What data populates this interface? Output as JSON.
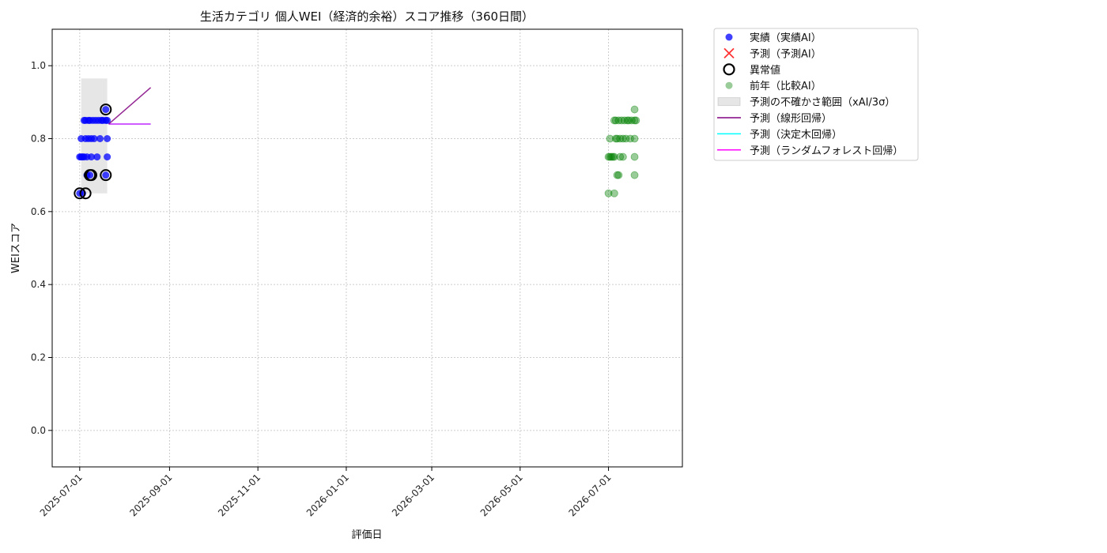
{
  "chart_data": {
    "type": "scatter",
    "title": "生活カテゴリ 個人WEI（経済的余裕）スコア推移（360日間）",
    "xlabel": "評価日",
    "ylabel": "WEIスコア",
    "x_type": "date",
    "xlim": [
      "2025-06-12",
      "2026-08-21"
    ],
    "ylim": [
      -0.1,
      1.1
    ],
    "grid": true,
    "legend_position": "outside-right-top",
    "x_ticks": [
      "2025-07-01",
      "2025-09-01",
      "2025-11-01",
      "2026-01-01",
      "2026-03-01",
      "2026-05-01",
      "2026-07-01"
    ],
    "y_ticks": [
      0.0,
      0.2,
      0.4,
      0.6,
      0.8,
      1.0
    ],
    "legend": [
      {
        "key": "actual",
        "label": "実績（実績AI）",
        "marker": "dot",
        "color": "#0000ff"
      },
      {
        "key": "forecast",
        "label": "予測（予測AI）",
        "marker": "x",
        "color": "#ff0000"
      },
      {
        "key": "anomaly",
        "label": "異常値",
        "marker": "ring",
        "color": "#000000"
      },
      {
        "key": "prev_year",
        "label": "前年（比較AI）",
        "marker": "dot",
        "color": "#008000"
      },
      {
        "key": "uncertainty",
        "label": "予測の不確かさ範囲（xAI/3σ）",
        "marker": "patch",
        "color": "#cccccc"
      },
      {
        "key": "linear",
        "label": "予測（線形回帰）",
        "marker": "line",
        "color": "#800080"
      },
      {
        "key": "tree",
        "label": "予測（決定木回帰）",
        "marker": "line",
        "color": "#00ffff"
      },
      {
        "key": "forest",
        "label": "予測（ランダムフォレスト回帰）",
        "marker": "line",
        "color": "#ff00ff"
      }
    ],
    "series": [
      {
        "key": "actual",
        "name": "実績（実績AI）",
        "color": "#0000ff",
        "points": [
          {
            "x": "2025-07-01",
            "y": 0.65
          },
          {
            "x": "2025-07-01",
            "y": 0.75
          },
          {
            "x": "2025-07-02",
            "y": 0.8
          },
          {
            "x": "2025-07-02",
            "y": 0.75
          },
          {
            "x": "2025-07-03",
            "y": 0.65
          },
          {
            "x": "2025-07-03",
            "y": 0.75
          },
          {
            "x": "2025-07-04",
            "y": 0.85
          },
          {
            "x": "2025-07-04",
            "y": 0.75
          },
          {
            "x": "2025-07-05",
            "y": 0.8
          },
          {
            "x": "2025-07-05",
            "y": 0.85
          },
          {
            "x": "2025-07-06",
            "y": 0.7
          },
          {
            "x": "2025-07-06",
            "y": 0.75
          },
          {
            "x": "2025-07-07",
            "y": 0.8
          },
          {
            "x": "2025-07-07",
            "y": 0.85
          },
          {
            "x": "2025-07-08",
            "y": 0.7
          },
          {
            "x": "2025-07-08",
            "y": 0.85
          },
          {
            "x": "2025-07-09",
            "y": 0.8
          },
          {
            "x": "2025-07-09",
            "y": 0.75
          },
          {
            "x": "2025-07-10",
            "y": 0.85
          },
          {
            "x": "2025-07-11",
            "y": 0.8
          },
          {
            "x": "2025-07-12",
            "y": 0.85
          },
          {
            "x": "2025-07-13",
            "y": 0.75
          },
          {
            "x": "2025-07-14",
            "y": 0.85
          },
          {
            "x": "2025-07-15",
            "y": 0.8
          },
          {
            "x": "2025-07-16",
            "y": 0.85
          },
          {
            "x": "2025-07-17",
            "y": 0.85
          },
          {
            "x": "2025-07-19",
            "y": 0.7
          },
          {
            "x": "2025-07-19",
            "y": 0.85
          },
          {
            "x": "2025-07-19",
            "y": 0.88
          },
          {
            "x": "2025-07-20",
            "y": 0.8
          },
          {
            "x": "2025-07-20",
            "y": 0.75
          },
          {
            "x": "2025-07-20",
            "y": 0.85
          }
        ]
      },
      {
        "key": "anomaly",
        "name": "異常値",
        "color": "#000000",
        "points": [
          {
            "x": "2025-07-01",
            "y": 0.65
          },
          {
            "x": "2025-07-05",
            "y": 0.65
          },
          {
            "x": "2025-07-08",
            "y": 0.7
          },
          {
            "x": "2025-07-09",
            "y": 0.7
          },
          {
            "x": "2025-07-19",
            "y": 0.7
          },
          {
            "x": "2025-07-19",
            "y": 0.88
          }
        ]
      },
      {
        "key": "prev_year",
        "name": "前年（比較AI）",
        "color": "#008000",
        "points": [
          {
            "x": "2026-07-01",
            "y": 0.65
          },
          {
            "x": "2026-07-01",
            "y": 0.75
          },
          {
            "x": "2026-07-02",
            "y": 0.8
          },
          {
            "x": "2026-07-02",
            "y": 0.75
          },
          {
            "x": "2026-07-03",
            "y": 0.75
          },
          {
            "x": "2026-07-04",
            "y": 0.75
          },
          {
            "x": "2026-07-05",
            "y": 0.65
          },
          {
            "x": "2026-07-05",
            "y": 0.75
          },
          {
            "x": "2026-07-05",
            "y": 0.85
          },
          {
            "x": "2026-07-06",
            "y": 0.8
          },
          {
            "x": "2026-07-06",
            "y": 0.85
          },
          {
            "x": "2026-07-07",
            "y": 0.7
          },
          {
            "x": "2026-07-07",
            "y": 0.8
          },
          {
            "x": "2026-07-08",
            "y": 0.7
          },
          {
            "x": "2026-07-08",
            "y": 0.85
          },
          {
            "x": "2026-07-09",
            "y": 0.75
          },
          {
            "x": "2026-07-09",
            "y": 0.8
          },
          {
            "x": "2026-07-10",
            "y": 0.85
          },
          {
            "x": "2026-07-11",
            "y": 0.75
          },
          {
            "x": "2026-07-11",
            "y": 0.8
          },
          {
            "x": "2026-07-12",
            "y": 0.85
          },
          {
            "x": "2026-07-13",
            "y": 0.8
          },
          {
            "x": "2026-07-14",
            "y": 0.85
          },
          {
            "x": "2026-07-15",
            "y": 0.85
          },
          {
            "x": "2026-07-16",
            "y": 0.8
          },
          {
            "x": "2026-07-17",
            "y": 0.85
          },
          {
            "x": "2026-07-19",
            "y": 0.7
          },
          {
            "x": "2026-07-19",
            "y": 0.75
          },
          {
            "x": "2026-07-19",
            "y": 0.8
          },
          {
            "x": "2026-07-19",
            "y": 0.85
          },
          {
            "x": "2026-07-19",
            "y": 0.88
          },
          {
            "x": "2026-07-20",
            "y": 0.85
          }
        ]
      },
      {
        "key": "linear",
        "name": "予測（線形回帰）",
        "color": "#800080",
        "points": [
          {
            "x": "2025-07-21",
            "y": 0.84
          },
          {
            "x": "2025-08-19",
            "y": 0.94
          }
        ]
      },
      {
        "key": "forest",
        "name": "予測（ランダムフォレスト回帰）",
        "color": "#ff00ff",
        "points": [
          {
            "x": "2025-07-21",
            "y": 0.84
          },
          {
            "x": "2025-08-19",
            "y": 0.84
          }
        ]
      },
      {
        "key": "tree",
        "name": "予測（決定木回帰）",
        "color": "#00ffff",
        "points": [
          {
            "x": "2025-07-21",
            "y": 0.84
          },
          {
            "x": "2025-08-19",
            "y": 0.84
          }
        ]
      }
    ],
    "uncertainty_band": {
      "x_start": "2025-07-02",
      "x_end": "2025-07-20",
      "y_low": 0.65,
      "y_high": 0.965
    }
  }
}
